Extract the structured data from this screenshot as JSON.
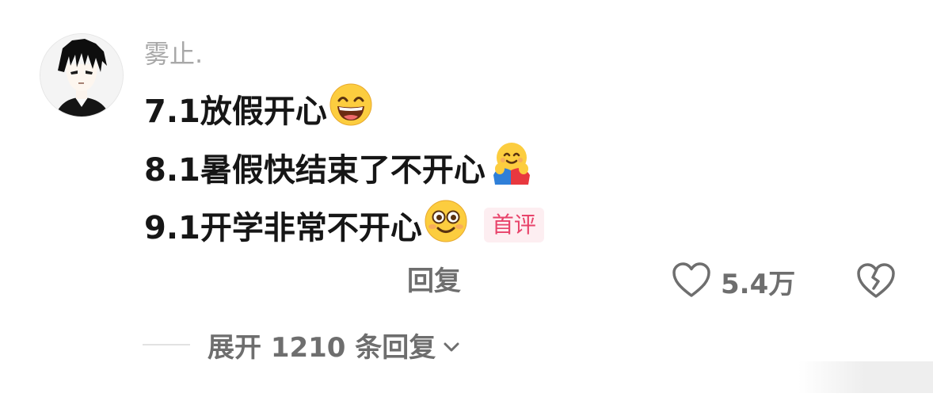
{
  "comment": {
    "username": "雾止.",
    "lines": [
      {
        "text": "7.1放假开心",
        "emoji": "grinning-face-emoji"
      },
      {
        "text": "8.1暑假快结束了不开心",
        "emoji": "hugging-face-emoji"
      },
      {
        "text": "9.1开学非常不开心",
        "emoji": "smiling-flushed-face-emoji"
      }
    ],
    "badge": "首评"
  },
  "actions": {
    "reply_label": "回复",
    "like_count": "5.4万",
    "like_icon": "heart-outline-icon",
    "dislike_icon": "broken-heart-icon"
  },
  "expand": {
    "label": "展开 1210 条回复",
    "icon": "chevron-down-icon"
  },
  "colors": {
    "username": "#a8a8a8",
    "text": "#161616",
    "muted": "#6e6e6e",
    "badge_text": "#e8436a",
    "badge_bg": "#fdeef1"
  }
}
